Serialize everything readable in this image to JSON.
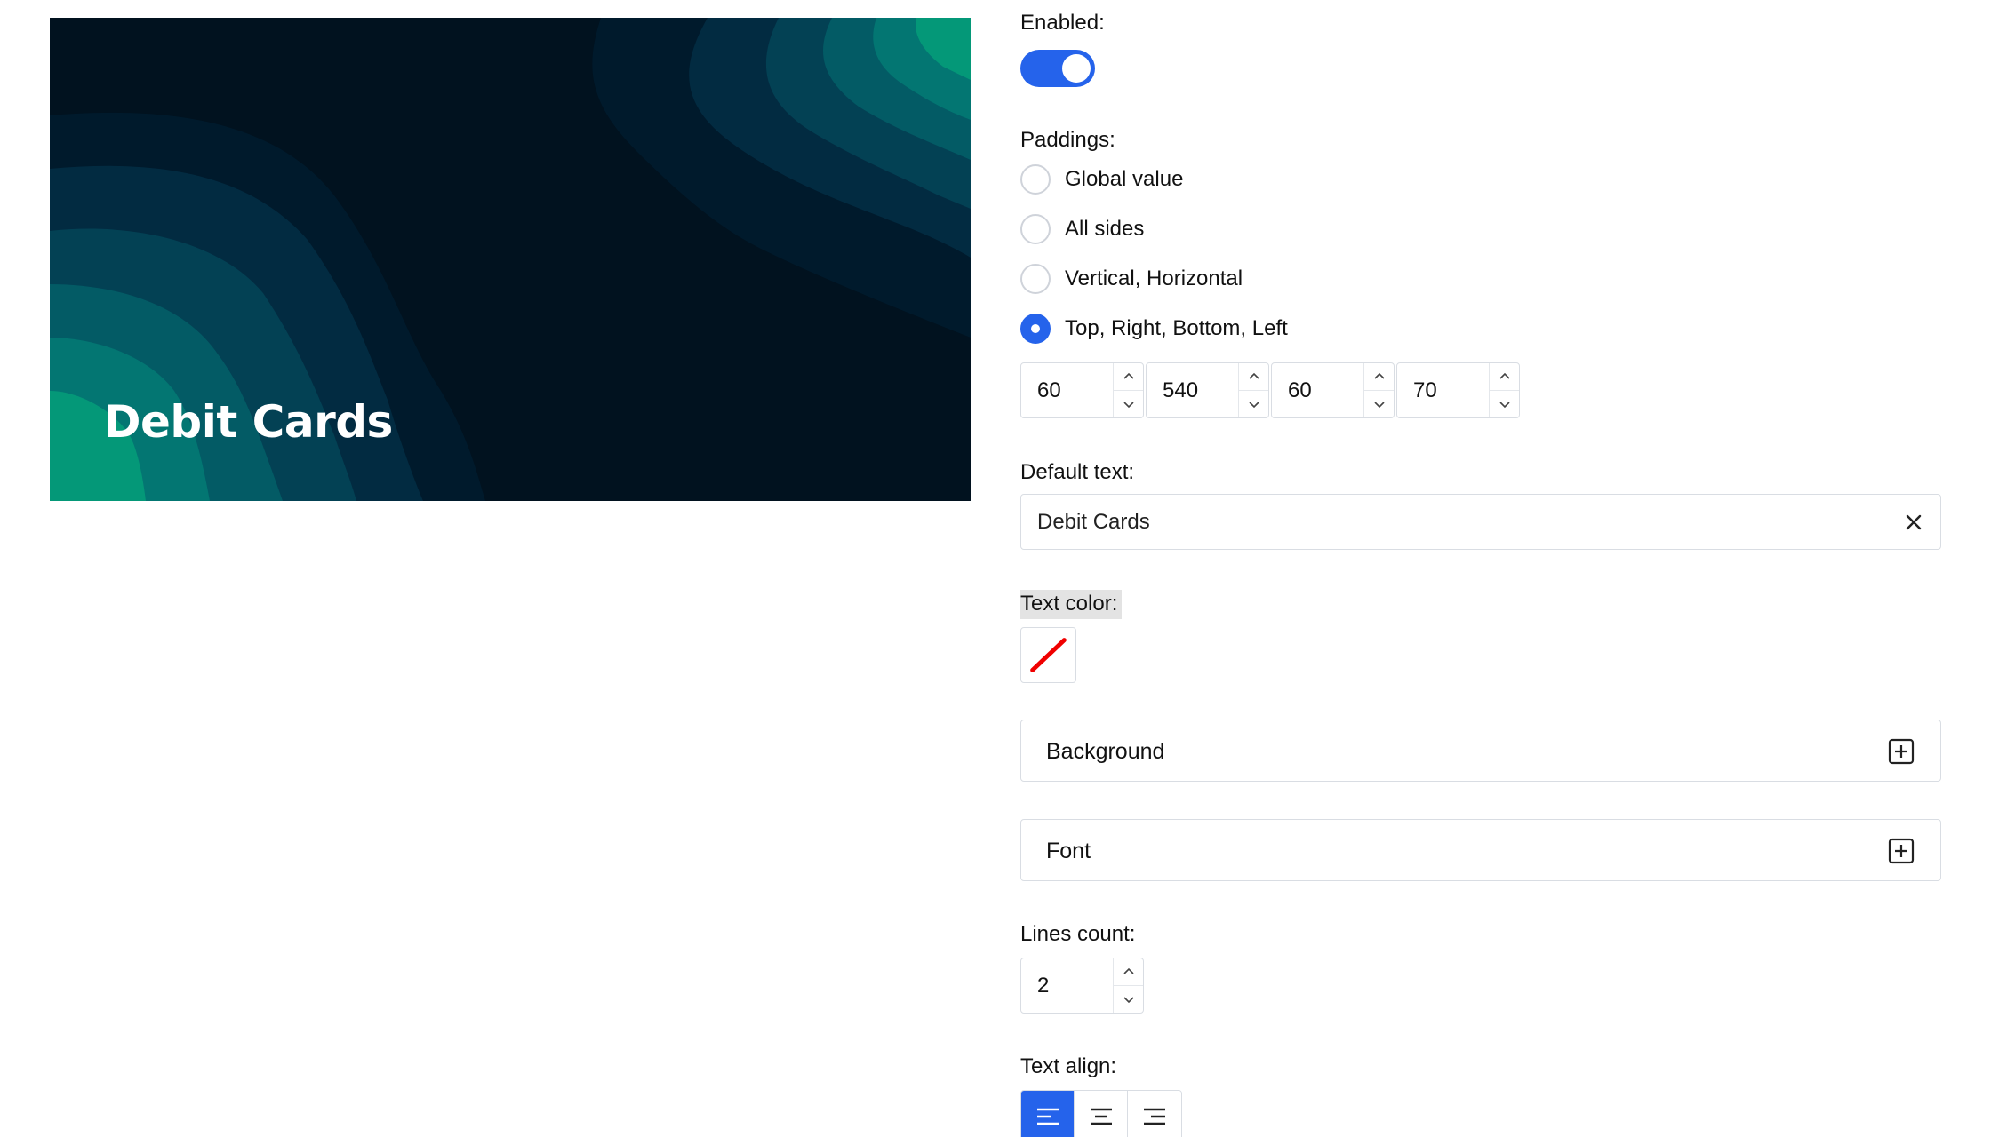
{
  "preview": {
    "title": "Debit Cards",
    "colors": {
      "bg": "#01121f",
      "band1": "#001a2c",
      "band2": "#022b41",
      "band3": "#034154",
      "band4": "#035b65",
      "band5": "#037672",
      "band6": "#049878"
    }
  },
  "settings": {
    "enabled": {
      "label": "Enabled:",
      "value": true
    },
    "paddings": {
      "label": "Paddings:",
      "options": [
        {
          "label": "Global value",
          "checked": false
        },
        {
          "label": "All sides",
          "checked": false
        },
        {
          "label": "Vertical, Horizontal",
          "checked": false
        },
        {
          "label": "Top, Right, Bottom, Left",
          "checked": true
        }
      ],
      "values": [
        "60",
        "540",
        "60",
        "70"
      ]
    },
    "default_text": {
      "label": "Default text:",
      "value": "Debit Cards"
    },
    "text_color": {
      "label": "Text color:",
      "value": "none"
    },
    "sections": [
      {
        "title": "Background",
        "icon": "plus-square-icon"
      },
      {
        "title": "Font",
        "icon": "plus-square-icon"
      }
    ],
    "lines_count": {
      "label": "Lines count:",
      "value": "2"
    },
    "text_align": {
      "label": "Text align:",
      "options": [
        "left",
        "center",
        "right"
      ],
      "selected": "left"
    },
    "accent_color": "#2563eb"
  }
}
